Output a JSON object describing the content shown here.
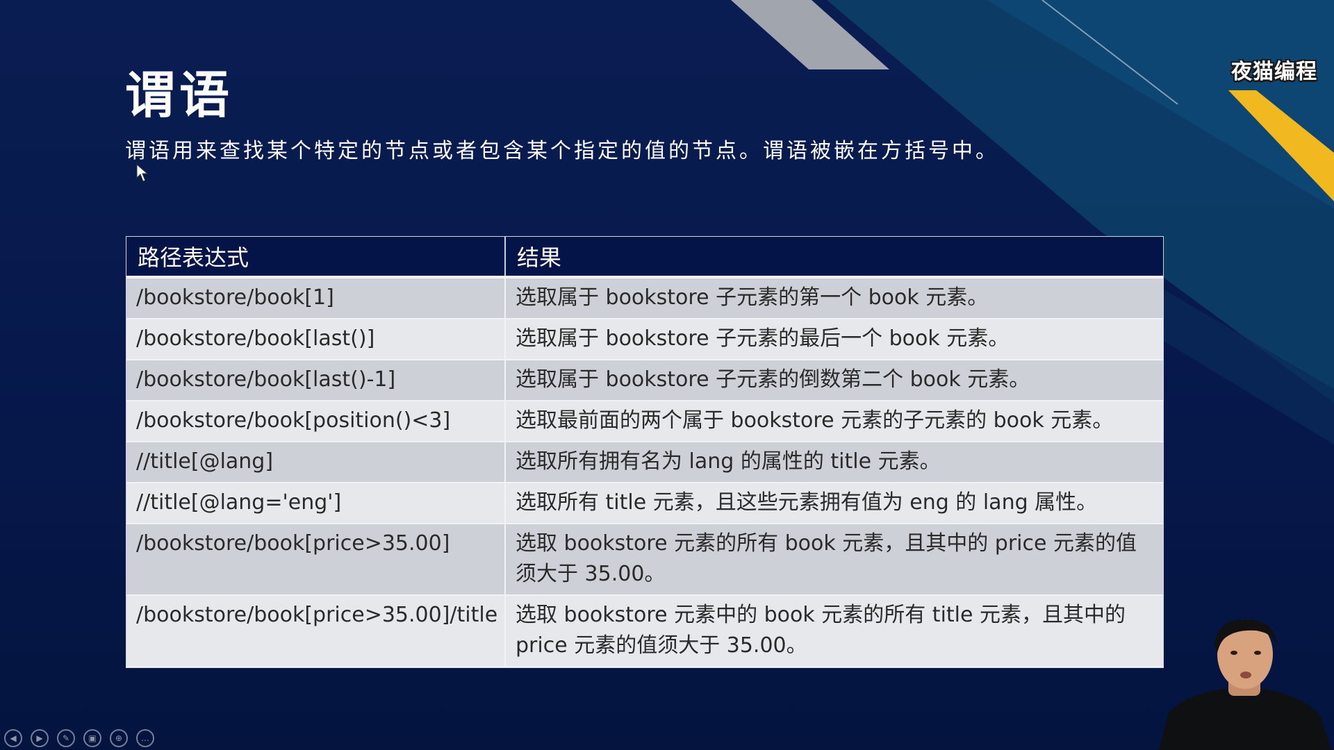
{
  "slide": {
    "title": "谓语",
    "subtitle": "谓语用来查找某个特定的节点或者包含某个指定的值的节点。谓语被嵌在方括号中。",
    "logo": "夜猫编程"
  },
  "table": {
    "headers": [
      "路径表达式",
      "结果"
    ],
    "rows": [
      [
        "/bookstore/book[1]",
        "选取属于 bookstore 子元素的第一个 book 元素。"
      ],
      [
        "/bookstore/book[last()]",
        "选取属于 bookstore 子元素的最后一个 book 元素。"
      ],
      [
        "/bookstore/book[last()-1]",
        "选取属于 bookstore 子元素的倒数第二个 book 元素。"
      ],
      [
        "/bookstore/book[position()<3]",
        "选取最前面的两个属于 bookstore 元素的子元素的 book 元素。"
      ],
      [
        "//title[@lang]",
        "选取所有拥有名为 lang 的属性的 title 元素。"
      ],
      [
        "//title[@lang='eng']",
        "选取所有 title 元素，且这些元素拥有值为 eng 的 lang 属性。"
      ],
      [
        "/bookstore/book[price>35.00]",
        "选取 bookstore 元素的所有 book 元素，且其中的 price 元素的值须大于 35.00。"
      ],
      [
        "/bookstore/book[price>35.00]/title",
        "选取 bookstore 元素中的 book 元素的所有 title 元素，且其中的 price 元素的值须大于 35.00。"
      ]
    ]
  },
  "controls": [
    {
      "icon": "prev-icon",
      "glyph": "◀"
    },
    {
      "icon": "next-icon",
      "glyph": "▶"
    },
    {
      "icon": "pen-icon",
      "glyph": "✎"
    },
    {
      "icon": "slides-icon",
      "glyph": "▣"
    },
    {
      "icon": "zoom-icon",
      "glyph": "⊕"
    },
    {
      "icon": "more-icon",
      "glyph": "…"
    }
  ],
  "colors": {
    "background": "#081a4a",
    "header": "#041448",
    "row_odd": "#cdd0d6",
    "row_even": "#e6e8ec",
    "accent_yellow": "#f1b81f"
  }
}
